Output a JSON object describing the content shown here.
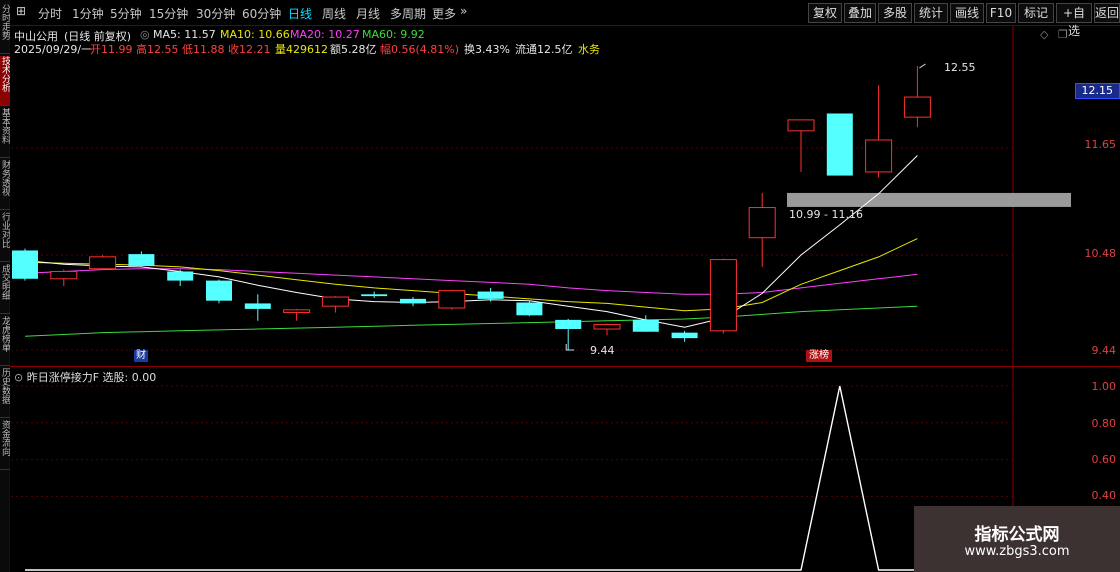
{
  "left_tabs": [
    "分时走势",
    "技术分析",
    "基本资料",
    "财务透视",
    "行业对比",
    "成交明细",
    "龙虎榜单",
    "历史数据",
    "资金流向"
  ],
  "toolbar": {
    "periods": [
      "分时",
      "1分钟",
      "5分钟",
      "15分钟",
      "30分钟",
      "60分钟",
      "日线",
      "周线",
      "月线",
      "多周期",
      "更多"
    ],
    "active_period": "日线",
    "buttons": [
      "复权",
      "叠加",
      "多股",
      "统计",
      "画线",
      "F10",
      "标记",
      "+自选",
      "返回"
    ]
  },
  "header": {
    "stock_name": "中山公用",
    "mode": "(日线 前复权)",
    "ma5_label": "MA5: 11.57",
    "ma10_label": "MA10: 10.66",
    "ma20_label": "MA20: 10.27",
    "ma60_label": "MA60: 9.92",
    "date": "2025/09/29/一",
    "open": "开11.99",
    "high": "高12.55",
    "low": "低11.88",
    "close": "收12.21",
    "volume": "量429612",
    "amount": "额5.28亿",
    "change": "幅0.56(4.81%)",
    "turnover": "换3.43%",
    "float_cap": "流通12.5亿",
    "sector": "水务"
  },
  "price_axis": [
    "11.65",
    "10.48",
    "9.44"
  ],
  "last_price_tag": "12.15",
  "annotations": {
    "high_mark": "12.55",
    "low_mark": "9.44",
    "zone_label": "10.99 - 11.16",
    "badge_left": "财",
    "badge_right": "涨榜"
  },
  "sub_indicator": {
    "title": "昨日涨停接力F",
    "value_label": "选股: 0.00",
    "axis": [
      "1.00",
      "0.80",
      "0.60",
      "0.40"
    ]
  },
  "watermark": {
    "title": "指标公式网",
    "url": "www.zbgs3.com"
  },
  "colors": {
    "up": "#ff3030",
    "down": "#54ffff",
    "ma5": "#ffffff",
    "ma10": "#e8e800",
    "ma20": "#ff40ff",
    "ma60": "#3cdc3c"
  },
  "chart_data": {
    "type": "candlestick",
    "y_range": [
      9.3,
      12.75
    ],
    "candles": [
      {
        "o": 10.53,
        "h": 10.55,
        "l": 10.2,
        "c": 10.22
      },
      {
        "o": 10.22,
        "h": 10.32,
        "l": 10.14,
        "c": 10.3
      },
      {
        "o": 10.33,
        "h": 10.48,
        "l": 10.32,
        "c": 10.46
      },
      {
        "o": 10.49,
        "h": 10.52,
        "l": 10.35,
        "c": 10.36
      },
      {
        "o": 10.3,
        "h": 10.32,
        "l": 10.14,
        "c": 10.2
      },
      {
        "o": 10.2,
        "h": 10.21,
        "l": 9.95,
        "c": 9.98
      },
      {
        "o": 9.95,
        "h": 10.05,
        "l": 9.76,
        "c": 9.89
      },
      {
        "o": 9.85,
        "h": 9.89,
        "l": 9.76,
        "c": 9.88
      },
      {
        "o": 9.92,
        "h": 10.03,
        "l": 9.85,
        "c": 10.02
      },
      {
        "o": 10.05,
        "h": 10.08,
        "l": 10.01,
        "c": 10.03
      },
      {
        "o": 10.0,
        "h": 10.02,
        "l": 9.92,
        "c": 9.95
      },
      {
        "o": 9.9,
        "h": 10.1,
        "l": 9.88,
        "c": 10.09
      },
      {
        "o": 10.08,
        "h": 10.12,
        "l": 9.97,
        "c": 10.0
      },
      {
        "o": 9.96,
        "h": 9.98,
        "l": 9.81,
        "c": 9.82
      },
      {
        "o": 9.77,
        "h": 9.78,
        "l": 9.44,
        "c": 9.67
      },
      {
        "o": 9.67,
        "h": 9.73,
        "l": 9.6,
        "c": 9.72
      },
      {
        "o": 9.77,
        "h": 9.82,
        "l": 9.64,
        "c": 9.64
      },
      {
        "o": 9.63,
        "h": 9.65,
        "l": 9.53,
        "c": 9.57
      },
      {
        "o": 9.65,
        "h": 10.44,
        "l": 9.62,
        "c": 10.43
      },
      {
        "o": 10.67,
        "h": 11.16,
        "l": 10.35,
        "c": 11.0
      },
      {
        "o": 11.84,
        "h": 11.88,
        "l": 11.39,
        "c": 11.96
      },
      {
        "o": 12.03,
        "h": 12.0,
        "l": 11.35,
        "c": 11.35
      },
      {
        "o": 11.39,
        "h": 12.34,
        "l": 11.33,
        "c": 11.74
      },
      {
        "o": 11.99,
        "h": 12.55,
        "l": 11.88,
        "c": 12.21
      }
    ],
    "ma5": [
      10.42,
      10.38,
      10.36,
      10.35,
      10.3,
      10.24,
      10.15,
      10.07,
      10.0,
      9.97,
      9.96,
      9.97,
      9.99,
      9.98,
      9.92,
      9.86,
      9.77,
      9.69,
      9.79,
      10.06,
      10.48,
      10.81,
      11.15,
      11.57
    ],
    "ma10": [
      10.4,
      10.39,
      10.38,
      10.37,
      10.35,
      10.31,
      10.26,
      10.21,
      10.16,
      10.12,
      10.09,
      10.06,
      10.03,
      10.0,
      9.97,
      9.95,
      9.91,
      9.87,
      9.89,
      9.96,
      10.16,
      10.31,
      10.46,
      10.66
    ],
    "ma20": [
      10.28,
      10.3,
      10.32,
      10.33,
      10.33,
      10.32,
      10.3,
      10.28,
      10.26,
      10.24,
      10.22,
      10.2,
      10.18,
      10.16,
      10.12,
      10.09,
      10.07,
      10.05,
      10.05,
      10.07,
      10.12,
      10.17,
      10.22,
      10.27
    ],
    "ma60": [
      9.59,
      9.61,
      9.63,
      9.64,
      9.65,
      9.66,
      9.67,
      9.68,
      9.69,
      9.7,
      9.71,
      9.72,
      9.73,
      9.74,
      9.75,
      9.76,
      9.77,
      9.78,
      9.8,
      9.83,
      9.86,
      9.88,
      9.9,
      9.92
    ],
    "zone": [
      10.99,
      11.16
    ],
    "signal": [
      0,
      0,
      0,
      0,
      0,
      0,
      0,
      0,
      0,
      0,
      0,
      0,
      0,
      0,
      0,
      0,
      0,
      0,
      0,
      0,
      0,
      1,
      0,
      0
    ],
    "signal_range": [
      0,
      1.0
    ]
  }
}
